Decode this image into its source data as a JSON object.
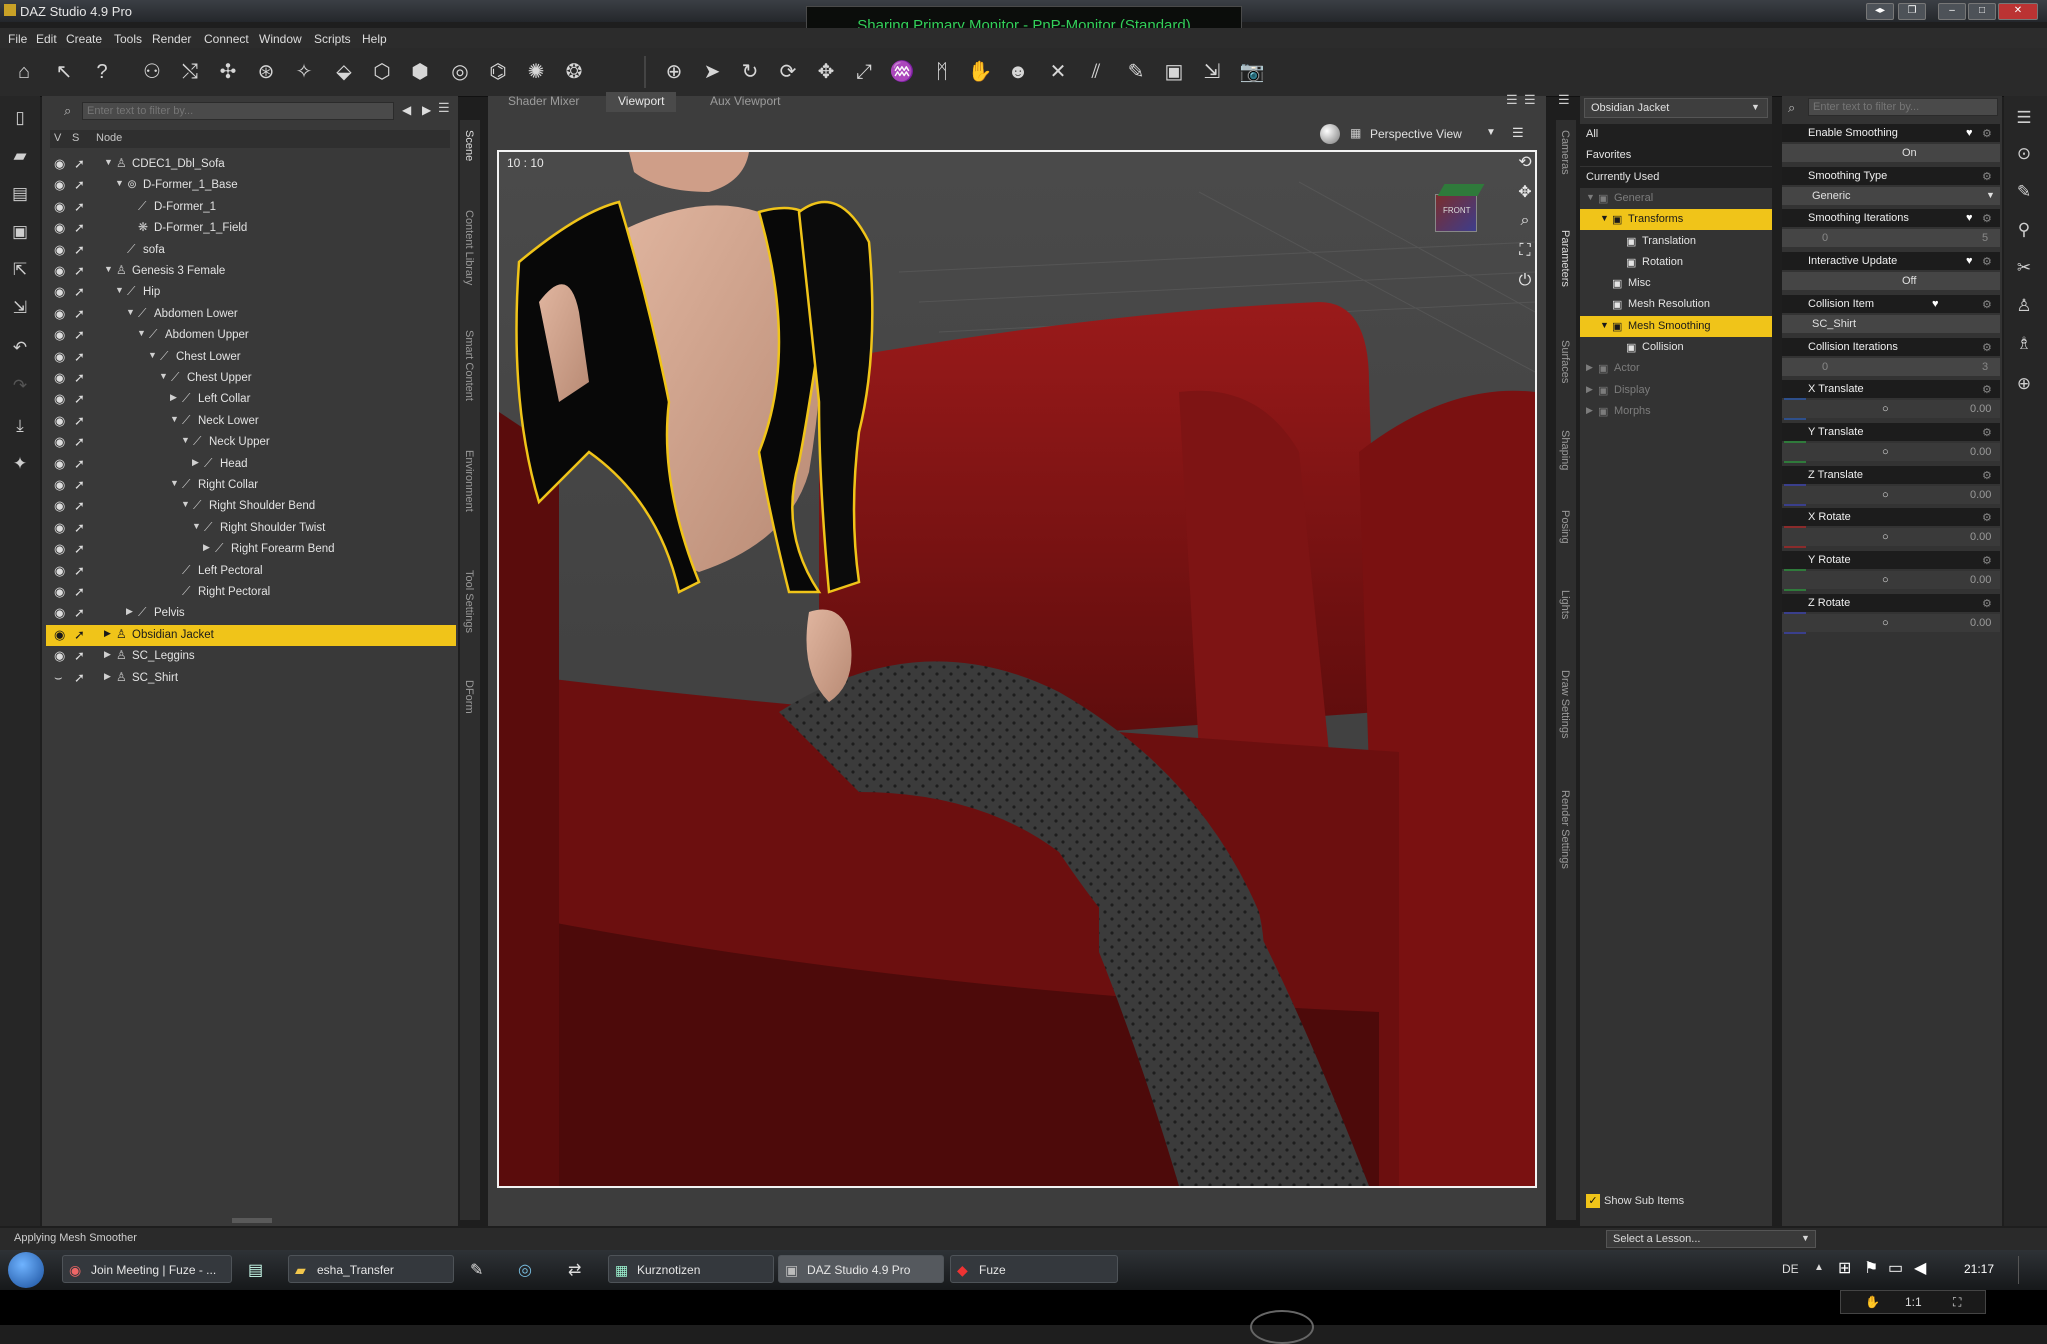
{
  "window": {
    "title": "DAZ Studio 4.9 Pro",
    "sharing_banner": "Sharing Primary Monitor - PnP-Monitor (Standard)"
  },
  "menu": [
    "File",
    "Edit",
    "Create",
    "Tools",
    "Render",
    "Connect",
    "Window",
    "Scripts",
    "Help"
  ],
  "toolbar_icons": [
    "home-icon",
    "whats-this-icon",
    "help-icon",
    "scene-figure-icon",
    "joint-editor-icon",
    "node-weight-icon",
    "rigging-icon",
    "surface-selection-icon",
    "geometry-editor-icon",
    "region-nav-icon",
    "node-selection-icon",
    "transform-icon",
    "spotrender-icon",
    "morph-icon",
    "universal-tool-icon",
    "pointer-icon",
    "rotate-icon",
    "twist-icon",
    "translate-icon",
    "scale-icon",
    "active-pose-icon",
    "posing-icon",
    "magnet-icon",
    "head-icon",
    "figure-icon",
    "align-icon",
    "tilt-icon",
    "edit-icon",
    "camera-icon",
    "pointer-extra-icon",
    "render-icon"
  ],
  "scene": {
    "filter_placeholder": "Enter text to filter by...",
    "col_v": "V",
    "col_s": "S",
    "col_node": "Node",
    "rows": [
      {
        "label": "CDEC1_Dbl_Sofa",
        "depth": 0,
        "expanded": true,
        "icon": "figure"
      },
      {
        "label": "D-Former_1_Base",
        "depth": 1,
        "expanded": true,
        "icon": "dformer"
      },
      {
        "label": "D-Former_1",
        "depth": 2,
        "expanded": null,
        "icon": "bone"
      },
      {
        "label": "D-Former_1_Field",
        "depth": 2,
        "expanded": null,
        "icon": "field"
      },
      {
        "label": "sofa",
        "depth": 1,
        "expanded": null,
        "icon": "bone"
      },
      {
        "label": "Genesis 3 Female",
        "depth": 0,
        "expanded": true,
        "icon": "figure"
      },
      {
        "label": "Hip",
        "depth": 1,
        "expanded": true,
        "icon": "bone"
      },
      {
        "label": "Abdomen Lower",
        "depth": 2,
        "expanded": true,
        "icon": "bone"
      },
      {
        "label": "Abdomen Upper",
        "depth": 3,
        "expanded": true,
        "icon": "bone"
      },
      {
        "label": "Chest Lower",
        "depth": 4,
        "expanded": true,
        "icon": "bone"
      },
      {
        "label": "Chest Upper",
        "depth": 5,
        "expanded": true,
        "icon": "bone"
      },
      {
        "label": "Left Collar",
        "depth": 6,
        "expanded": false,
        "icon": "bone"
      },
      {
        "label": "Neck Lower",
        "depth": 6,
        "expanded": true,
        "icon": "bone"
      },
      {
        "label": "Neck Upper",
        "depth": 7,
        "expanded": true,
        "icon": "bone"
      },
      {
        "label": "Head",
        "depth": 8,
        "expanded": false,
        "icon": "bone"
      },
      {
        "label": "Right Collar",
        "depth": 6,
        "expanded": true,
        "icon": "bone"
      },
      {
        "label": "Right Shoulder Bend",
        "depth": 7,
        "expanded": true,
        "icon": "bone"
      },
      {
        "label": "Right Shoulder Twist",
        "depth": 8,
        "expanded": true,
        "icon": "bone"
      },
      {
        "label": "Right Forearm Bend",
        "depth": 9,
        "expanded": false,
        "icon": "bone"
      },
      {
        "label": "Left Pectoral",
        "depth": 6,
        "expanded": null,
        "icon": "bone"
      },
      {
        "label": "Right Pectoral",
        "depth": 6,
        "expanded": null,
        "icon": "bone"
      },
      {
        "label": "Pelvis",
        "depth": 2,
        "expanded": false,
        "icon": "bone"
      },
      {
        "label": "Obsidian Jacket",
        "depth": 0,
        "expanded": false,
        "icon": "figure",
        "selected": true
      },
      {
        "label": "SC_Leggins",
        "depth": 0,
        "expanded": false,
        "icon": "figure"
      },
      {
        "label": "SC_Shirt",
        "depth": 0,
        "expanded": false,
        "icon": "figure",
        "hidden": true
      }
    ]
  },
  "left_vertical_tabs": [
    "Scene",
    "Content Library",
    "Smart Content",
    "Environment",
    "Tool Settings",
    "DForm"
  ],
  "viewport": {
    "tabs": [
      "Shader Mixer",
      "Viewport",
      "Aux Viewport"
    ],
    "active_tab": "Viewport",
    "camera": "Perspective View",
    "aspect_ratio": "10 : 10",
    "cube_label": "FRONT"
  },
  "right_vertical_tabs": [
    "Cameras",
    "Parameters",
    "Surfaces",
    "Shaping",
    "Posing",
    "Lights",
    "Draw Settings",
    "Render Settings"
  ],
  "parameters": {
    "node_selector": "Obsidian Jacket",
    "filter_placeholder": "Enter text to filter by...",
    "tree": [
      {
        "label": "All",
        "style": "dark",
        "indent": 0
      },
      {
        "label": "Favorites",
        "style": "dark",
        "indent": 0
      },
      {
        "label": "Currently Used",
        "style": "dark",
        "indent": 0
      },
      {
        "label": "General",
        "style": "dim",
        "indent": 0,
        "tri": "▼"
      },
      {
        "label": "Transforms",
        "style": "hl",
        "indent": 1,
        "tri": "▼"
      },
      {
        "label": "Translation",
        "style": "normal",
        "indent": 2
      },
      {
        "label": "Rotation",
        "style": "normal",
        "indent": 2
      },
      {
        "label": "Misc",
        "style": "normal",
        "indent": 1
      },
      {
        "label": "Mesh Resolution",
        "style": "normal",
        "indent": 1
      },
      {
        "label": "Mesh Smoothing",
        "style": "hl",
        "indent": 1,
        "tri": "▼"
      },
      {
        "label": "Collision",
        "style": "normal",
        "indent": 2
      },
      {
        "label": "Actor",
        "style": "dim",
        "indent": 0,
        "tri": "▶"
      },
      {
        "label": "Display",
        "style": "dim",
        "indent": 0,
        "tri": "▶"
      },
      {
        "label": "Morphs",
        "style": "dim",
        "indent": 0,
        "tri": "▶"
      }
    ],
    "show_sub_items": "Show Sub Items",
    "properties": [
      {
        "name": "Enable Smoothing",
        "kind": "toggle",
        "value": "On"
      },
      {
        "name": "Smoothing Type",
        "kind": "select",
        "value": "Generic"
      },
      {
        "name": "Smoothing Iterations",
        "kind": "slider",
        "min": "0",
        "max": "5"
      },
      {
        "name": "Interactive Update",
        "kind": "toggle",
        "value": "Off"
      },
      {
        "name": "Collision Item",
        "kind": "text",
        "value": "SC_Shirt"
      },
      {
        "name": "Collision Iterations",
        "kind": "slider",
        "min": "0",
        "max": "3"
      },
      {
        "name": "X Translate",
        "kind": "num",
        "value": "0.00",
        "icon": "translate-icon",
        "color": "#2e4f8a"
      },
      {
        "name": "Y Translate",
        "kind": "num",
        "value": "0.00",
        "icon": "translate-icon",
        "color": "#2f7a3b"
      },
      {
        "name": "Z Translate",
        "kind": "num",
        "value": "0.00",
        "icon": "translate-icon",
        "color": "#3a3f8c"
      },
      {
        "name": "X Rotate",
        "kind": "num",
        "value": "0.00",
        "icon": "rotate-icon",
        "color": "#8a2b2b"
      },
      {
        "name": "Y Rotate",
        "kind": "num",
        "value": "0.00",
        "icon": "rotate-icon",
        "color": "#2f7a3b"
      },
      {
        "name": "Z Rotate",
        "kind": "num",
        "value": "0.00",
        "icon": "rotate-icon",
        "color": "#3a3f8c"
      }
    ]
  },
  "status": {
    "message": "Applying Mesh Smoother",
    "lesson": "Select a Lesson..."
  },
  "taskbar": {
    "apps": [
      "Join Meeting | Fuze - ...",
      "esha_Transfer",
      "Kurznotizen",
      "DAZ Studio 4.9 Pro",
      "Fuze"
    ],
    "active": "DAZ Studio 4.9 Pro",
    "lang": "DE",
    "time": "21:17",
    "zoom": "1:1"
  },
  "colors": {
    "selection": "#f0c419",
    "sofa": "#8a1414",
    "sharing_text": "#33d05a"
  }
}
